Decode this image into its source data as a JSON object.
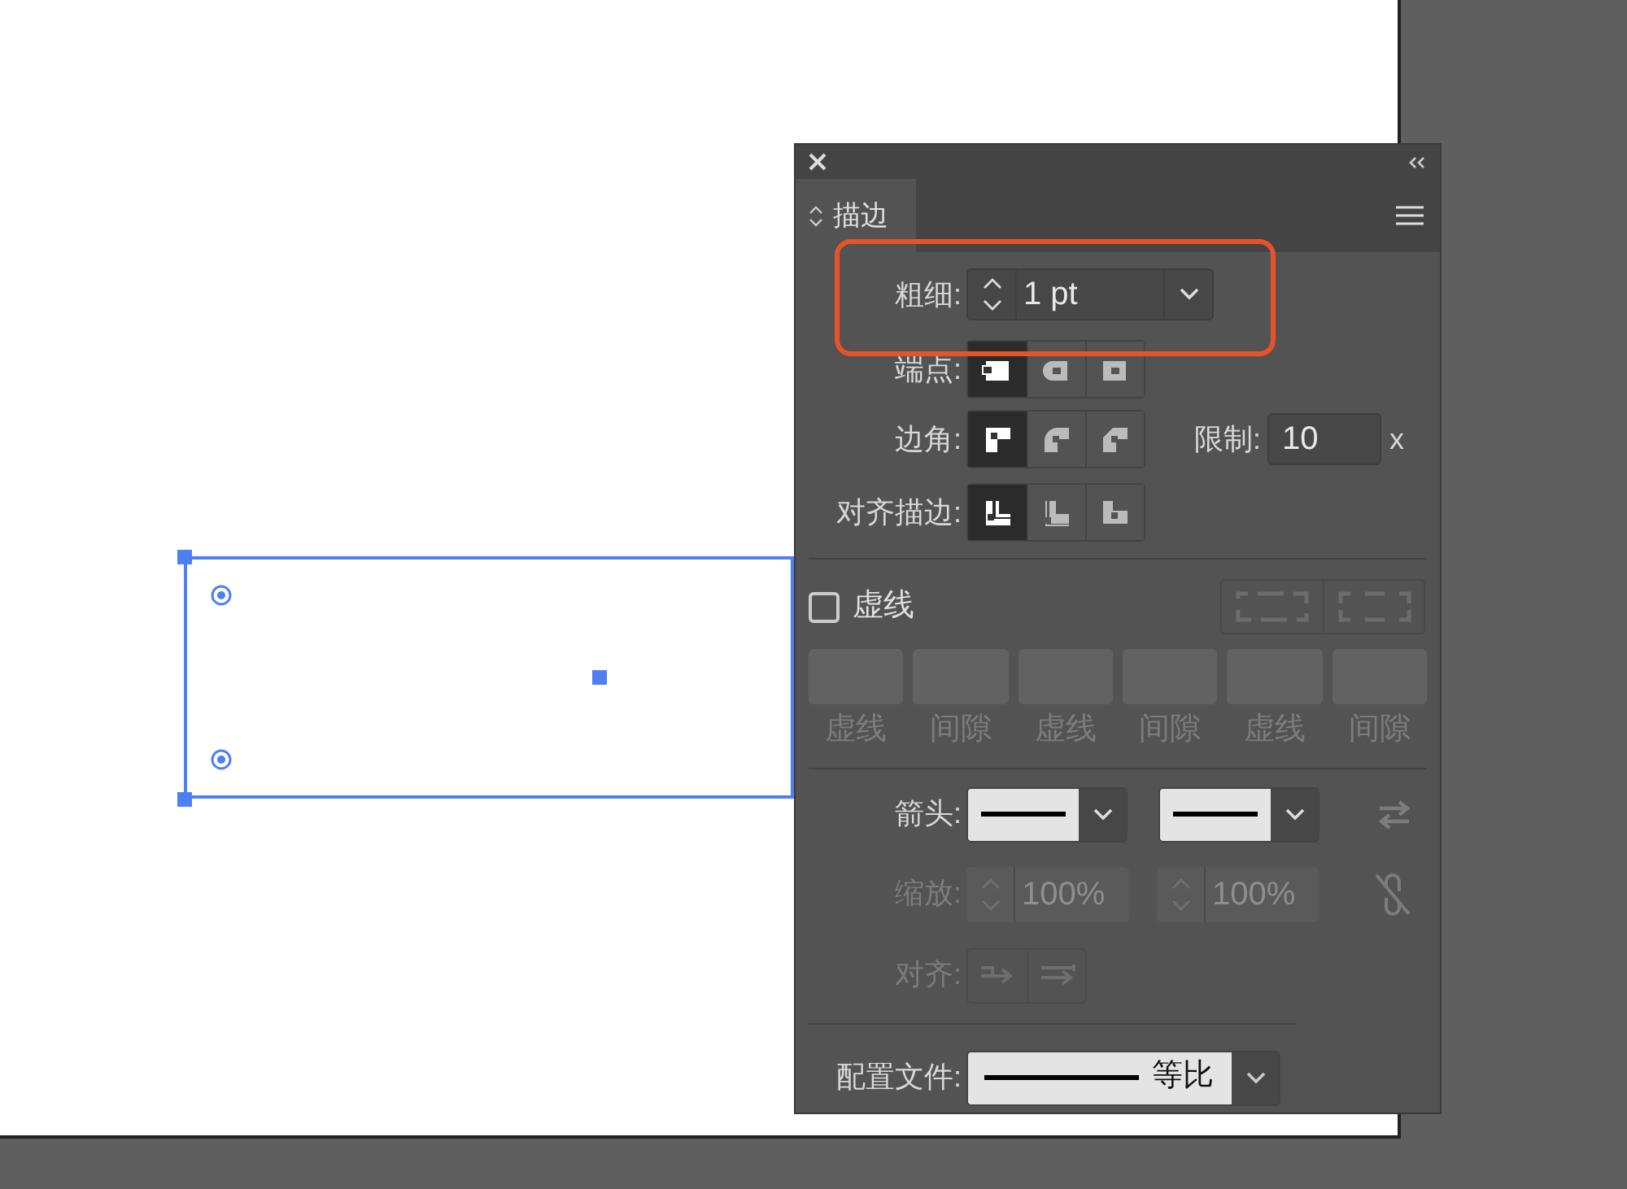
{
  "panel": {
    "tab": "描边",
    "weight": {
      "label": "粗细:",
      "value": "1 pt"
    },
    "cap": {
      "label": "端点:",
      "options": [
        {
          "selected": true
        },
        {
          "selected": false
        },
        {
          "selected": false
        }
      ]
    },
    "corner": {
      "label": "边角:",
      "options": [
        {
          "selected": true
        },
        {
          "selected": false
        },
        {
          "selected": false
        }
      ],
      "limit_label": "限制:",
      "limit_value": "10",
      "limit_unit": "x"
    },
    "align": {
      "label": "对齐描边:",
      "options": [
        {
          "selected": true
        },
        {
          "selected": false
        },
        {
          "selected": false
        }
      ]
    },
    "dashed": {
      "label": "虚线",
      "checked": false,
      "fields": [
        "虚线",
        "间隙",
        "虚线",
        "间隙",
        "虚线",
        "间隙"
      ]
    },
    "arrowheads": {
      "label": "箭头:"
    },
    "scale": {
      "label": "缩放:",
      "start": "100%",
      "end": "100%"
    },
    "arrow_align": {
      "label": "对齐:"
    },
    "profile": {
      "label": "配置文件:",
      "value": "等比"
    }
  }
}
